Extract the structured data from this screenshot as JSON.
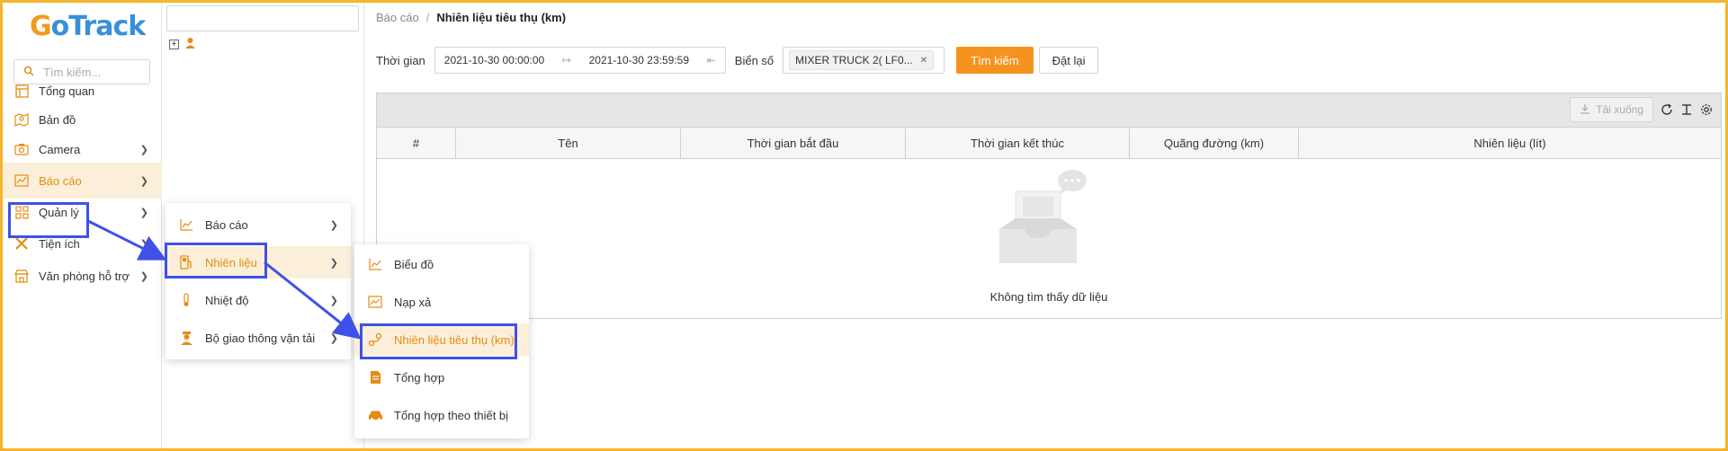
{
  "app": {
    "logo_first": "G",
    "logo_rest": "oTrack"
  },
  "sidebar": {
    "search_placeholder": "Tìm kiếm...",
    "items": [
      {
        "label": "Tổng quan",
        "icon": "dashboard-icon",
        "has_chevron": false
      },
      {
        "label": "Bản đồ",
        "icon": "map-icon",
        "has_chevron": false
      },
      {
        "label": "Camera",
        "icon": "camera-icon",
        "has_chevron": true
      },
      {
        "label": "Báo cáo",
        "icon": "report-chart-icon",
        "has_chevron": true,
        "active": true
      },
      {
        "label": "Quản lý",
        "icon": "grid-icon",
        "has_chevron": true
      },
      {
        "label": "Tiện ích",
        "icon": "tools-icon",
        "has_chevron": true
      },
      {
        "label": "Văn phòng hỗ trợ",
        "icon": "store-icon",
        "has_chevron": true
      }
    ]
  },
  "submenu1": {
    "items": [
      {
        "label": "Báo cáo",
        "icon": "line-chart-icon"
      },
      {
        "label": "Nhiên liệu",
        "icon": "fuel-pump-icon",
        "active": true
      },
      {
        "label": "Nhiệt độ",
        "icon": "thermometer-icon"
      },
      {
        "label": "Bộ giao thông vận tải",
        "icon": "officer-icon"
      }
    ]
  },
  "submenu2": {
    "items": [
      {
        "label": "Biểu đồ",
        "icon": "line-chart-icon"
      },
      {
        "label": "Nạp xả",
        "icon": "area-chart-icon"
      },
      {
        "label": "Nhiên liệu tiêu thụ (km)",
        "icon": "route-icon",
        "active": true
      },
      {
        "label": "Tổng hợp",
        "icon": "document-icon"
      },
      {
        "label": "Tổng hợp theo thiết bị",
        "icon": "car-icon"
      }
    ]
  },
  "breadcrumb": {
    "parent": "Báo cáo",
    "separator": "/",
    "current": "Nhiên liệu tiêu thụ (km)"
  },
  "filter": {
    "time_label": "Thời gian",
    "date_from": "2021-10-30 00:00:00",
    "date_to": "2021-10-30 23:59:59",
    "plate_label": "Biển số",
    "plate_tag": "MIXER TRUCK 2( LF0...",
    "search_button": "Tìm kiếm",
    "reset_button": "Đặt lại"
  },
  "toolbar": {
    "download_label": "Tải xuống"
  },
  "table": {
    "columns": [
      "#",
      "Tên",
      "Thời gian bắt đầu",
      "Thời gian kết thúc",
      "Quãng đường (km)",
      "Nhiên liệu (lít)"
    ],
    "empty_text": "Không tìm thấy dữ liệu",
    "rows": []
  },
  "colors": {
    "accent": "#f5931f",
    "highlight": "#3f51e6",
    "frame": "#f5b52e",
    "active_bg": "#fcefd9"
  }
}
